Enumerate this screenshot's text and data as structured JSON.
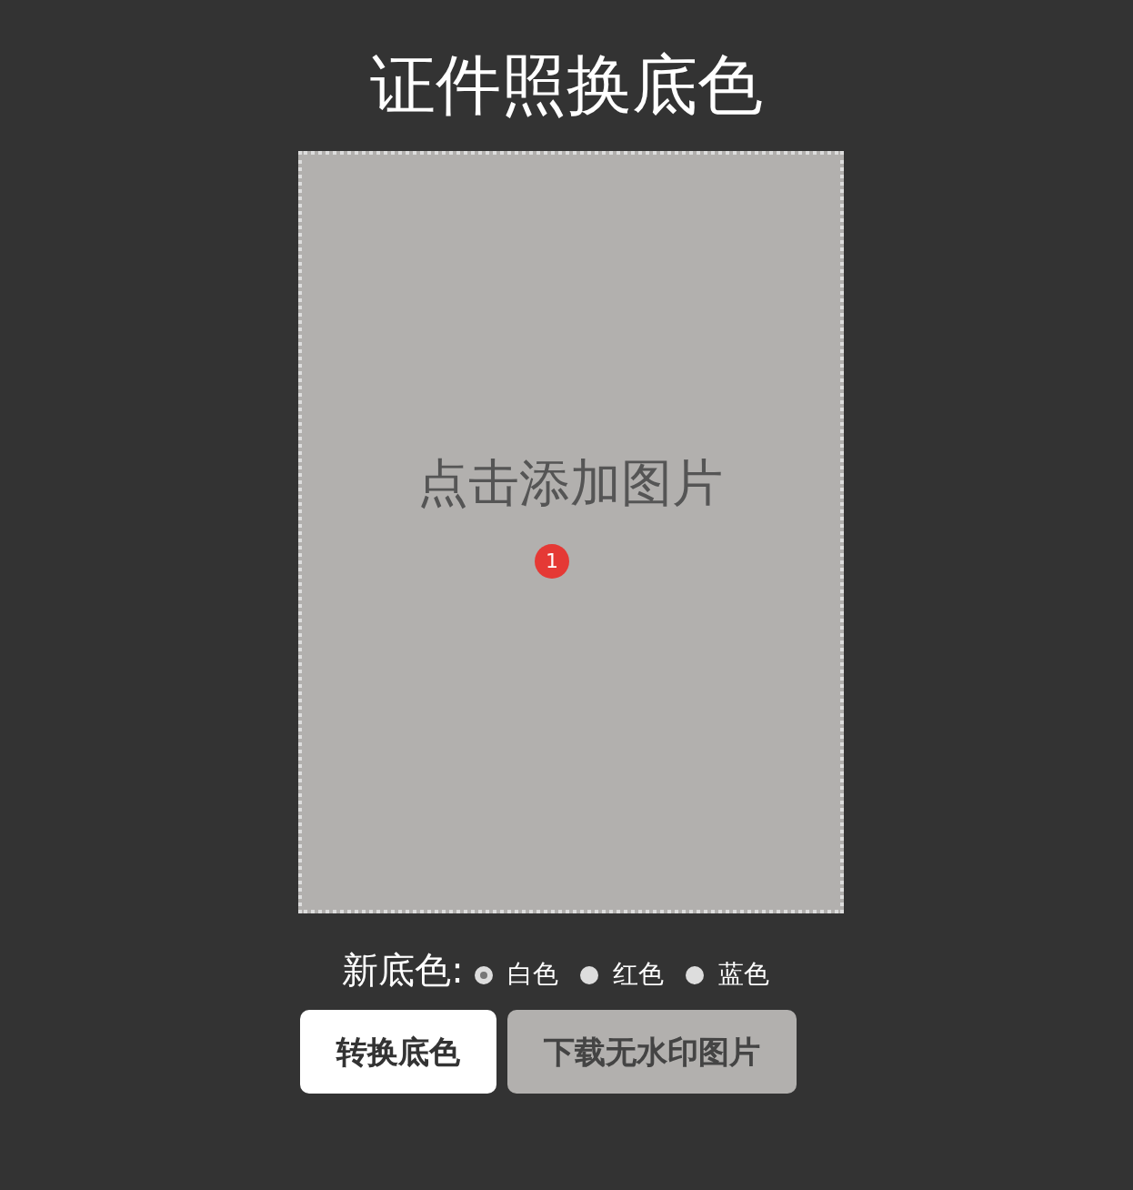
{
  "title": "证件照换底色",
  "upload": {
    "prompt": "点击添加图片",
    "badge": "1"
  },
  "background": {
    "label": "新底色:",
    "options": [
      {
        "label": "白色",
        "selected": true
      },
      {
        "label": "红色",
        "selected": false
      },
      {
        "label": "蓝色",
        "selected": false
      }
    ]
  },
  "buttons": [
    {
      "label": "转换底色",
      "disabled": false
    },
    {
      "label": "下载无水印图片",
      "disabled": true
    }
  ]
}
